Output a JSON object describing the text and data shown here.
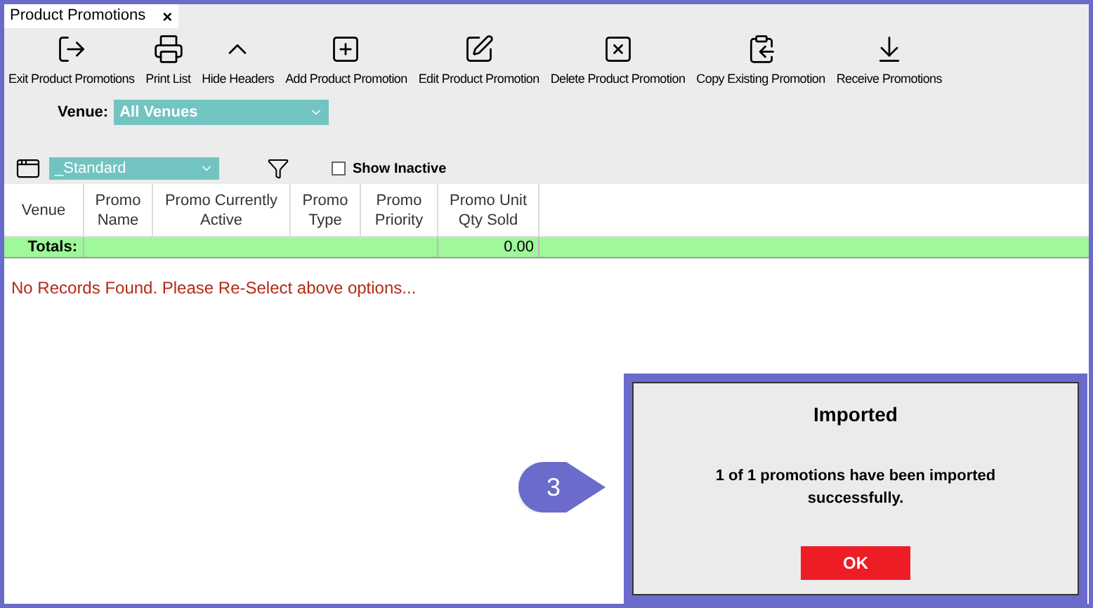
{
  "tab": {
    "title": "Product Promotions",
    "close": "×"
  },
  "toolbar": [
    {
      "label": "Exit Product Promotions",
      "kind": "exit"
    },
    {
      "label": "Print List",
      "kind": "print"
    },
    {
      "label": "Hide Headers",
      "kind": "hide"
    },
    {
      "label": "Add Product Promotion",
      "kind": "add"
    },
    {
      "label": "Edit Product Promotion",
      "kind": "edit"
    },
    {
      "label": "Delete Product Promotion",
      "kind": "delete"
    },
    {
      "label": "Copy Existing Promotion",
      "kind": "copy"
    },
    {
      "label": "Receive Promotions",
      "kind": "receive"
    }
  ],
  "venue": {
    "label": "Venue:",
    "value": "All Venues"
  },
  "layout": {
    "value": "_Standard"
  },
  "show_inactive": {
    "label": "Show Inactive",
    "checked": false
  },
  "table": {
    "columns": [
      "Venue",
      "Promo Name",
      "Promo Currently Active",
      "Promo Type",
      "Promo Priority",
      "Promo Unit Qty Sold"
    ],
    "totals": {
      "label": "Totals:",
      "qty_sold": "0.00"
    },
    "empty_message": "No Records Found. Please Re-Select above options..."
  },
  "callout": {
    "number": "3"
  },
  "dialog": {
    "title": "Imported",
    "message": "1 of 1 promotions have been imported successfully.",
    "button": "OK"
  }
}
